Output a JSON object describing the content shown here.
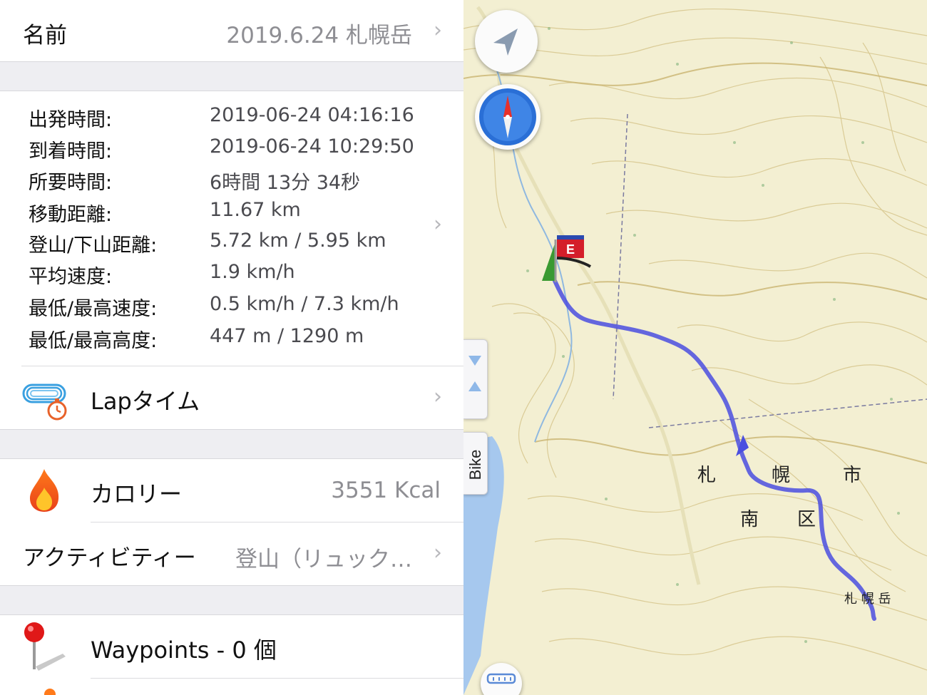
{
  "record": {
    "name_label": "名前",
    "name_value": "2019.6.24 札幌岳"
  },
  "stats": [
    {
      "label": "出発時間:",
      "value": "2019-06-24 04:16:16"
    },
    {
      "label": "到着時間:",
      "value": "2019-06-24 10:29:50"
    },
    {
      "label": "所要時間:",
      "value": "6時間 13分 34秒"
    },
    {
      "label": "移動距離:",
      "value": "11.67 km"
    },
    {
      "label": "登山/下山距離:",
      "value": "5.72 km / 5.95 km"
    },
    {
      "label": "平均速度:",
      "value": "1.9 km/h"
    },
    {
      "label": "最低/最高速度:",
      "value": "0.5 km/h / 7.3 km/h"
    },
    {
      "label": "最低/最高高度:",
      "value": "447 m / 1290 m"
    }
  ],
  "lap": {
    "label": "Lapタイム",
    "icon": "lap-stopwatch-icon"
  },
  "calorie": {
    "label": "カロリー",
    "value": "3551 Kcal",
    "icon": "flame-icon"
  },
  "activity": {
    "label": "アクティビティー",
    "value": "登山（リュック…"
  },
  "waypoints": {
    "label": "Waypoints - 0 個",
    "icon": "pin-icon"
  },
  "map": {
    "flag_label": "E",
    "bike_tab_label": "Bike",
    "place_labels": {
      "sapporo": "札",
      "horo": "幌",
      "shi": "市",
      "minami": "南",
      "ku": "区",
      "peak": "札 幌 岳"
    },
    "colors": {
      "track": "#4a4ee0",
      "water": "#a6c8ee",
      "accent": "#2a6fd6"
    }
  }
}
